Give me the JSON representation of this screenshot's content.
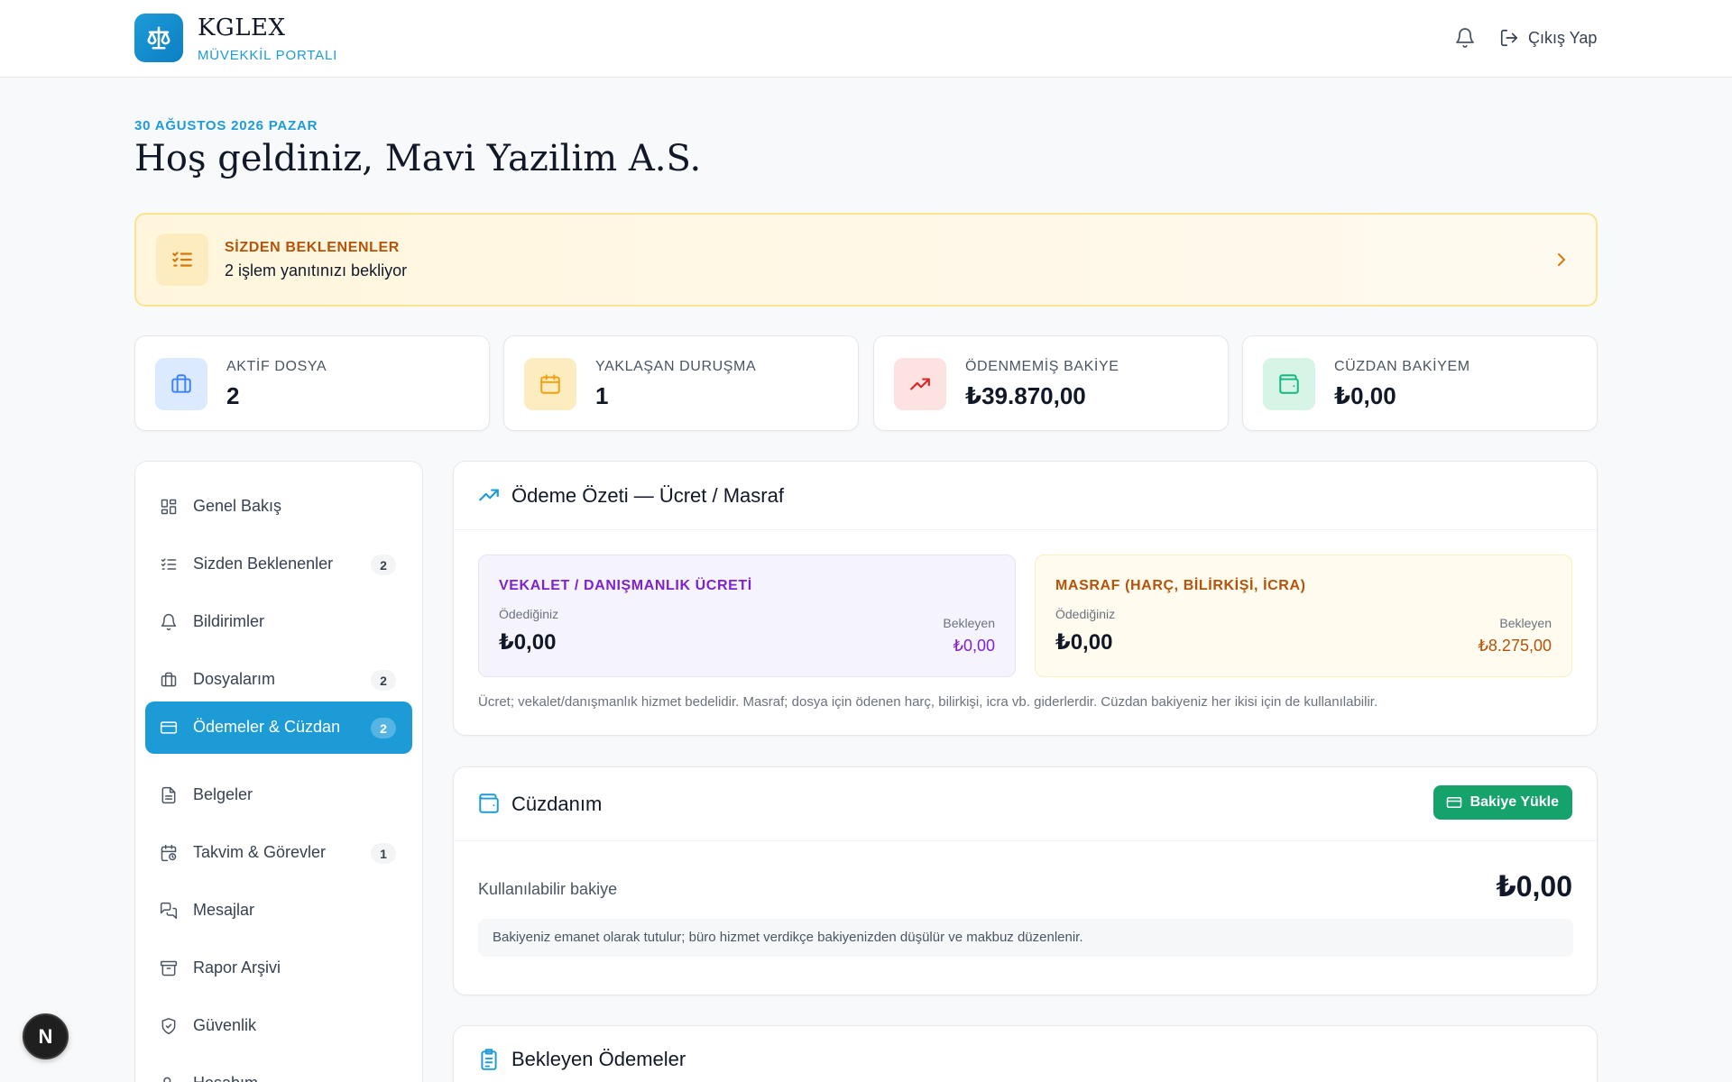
{
  "header": {
    "brand_title": "KGLEX",
    "brand_subtitle": "MÜVEKKİL PORTALI",
    "logout_label": "Çıkış Yap"
  },
  "welcome": {
    "date": "30 AĞUSTOS 2026 PAZAR",
    "greeting": "Hoş geldiniz, Mavi Yazilim A.S."
  },
  "pending_banner": {
    "title": "SİZDEN BEKLENENLER",
    "text": "2 işlem yanıtınızı bekliyor"
  },
  "stats": [
    {
      "label": "AKTİF DOSYA",
      "value": "2",
      "icon": "briefcase-icon",
      "color": "#3b82f6"
    },
    {
      "label": "YAKLAŞAN DURUŞMA",
      "value": "1",
      "icon": "calendar-icon",
      "color": "#f59e0b"
    },
    {
      "label": "ÖDENMEMİŞ BAKİYE",
      "value": "₺39.870,00",
      "icon": "trending-up-icon",
      "color": "#ef4444"
    },
    {
      "label": "CÜZDAN BAKİYEM",
      "value": "₺0,00",
      "icon": "wallet-icon",
      "color": "#10b981"
    }
  ],
  "sidebar": {
    "items": [
      {
        "label": "Genel Bakış",
        "icon": "grid-icon"
      },
      {
        "label": "Sizden Beklenenler",
        "icon": "checklist-icon",
        "badge": "2"
      },
      {
        "label": "Bildirimler",
        "icon": "bell-icon"
      },
      {
        "label": "Dosyalarım",
        "icon": "briefcase-icon",
        "badge": "2"
      },
      {
        "label": "Ödemeler & Cüzdan",
        "icon": "credit-card-icon",
        "badge": "2",
        "active": true
      },
      {
        "label": "Belgeler",
        "icon": "document-icon"
      },
      {
        "label": "Takvim & Görevler",
        "icon": "calendar-clock-icon",
        "badge": "1"
      },
      {
        "label": "Mesajlar",
        "icon": "messages-icon"
      },
      {
        "label": "Rapor Arşivi",
        "icon": "archive-icon"
      },
      {
        "label": "Güvenlik",
        "icon": "shield-icon"
      },
      {
        "label": "Hesabım",
        "icon": "user-settings-icon"
      }
    ]
  },
  "payment_summary": {
    "title": "Ödeme Özeti — Ücret / Masraf",
    "fee": {
      "title": "VEKALET / DANIŞMANLIK ÜCRETİ",
      "paid_label": "Ödediğiniz",
      "paid_value": "₺0,00",
      "pending_label": "Bekleyen",
      "pending_value": "₺0,00"
    },
    "expense": {
      "title": "MASRAF (HARÇ, BİLİRKİŞİ, İCRA)",
      "paid_label": "Ödediğiniz",
      "paid_value": "₺0,00",
      "pending_label": "Bekleyen",
      "pending_value": "₺8.275,00"
    },
    "note": "Ücret; vekalet/danışmanlık hizmet bedelidir. Masraf; dosya için ödenen harç, bilirkişi, icra vb. giderlerdir. Cüzdan bakiyeniz her ikisi için de kullanılabilir."
  },
  "wallet": {
    "title": "Cüzdanım",
    "topup_label": "Bakiye Yükle",
    "available_label": "Kullanılabilir bakiye",
    "available_value": "₺0,00",
    "note": "Bakiyeniz emanet olarak tutulur; büro hizmet verdikçe bakiyenizden düşülür ve makbuz düzenlenir."
  },
  "pending_payments": {
    "title": "Bekleyen Ödemeler"
  },
  "fab": {
    "label": "N"
  },
  "colors": {
    "accent": "#1d9bd7",
    "success": "#15a36b",
    "fee_purple": "#7e22ce",
    "expense_orange": "#b45309"
  }
}
